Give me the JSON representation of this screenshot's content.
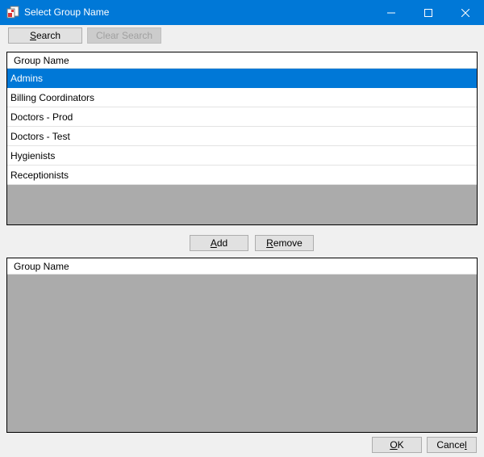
{
  "window": {
    "title": "Select Group Name",
    "icon": "app-window-icon",
    "accent": "#0078d7"
  },
  "toolbar": {
    "search_prefix": "S",
    "search_label": "earch",
    "clear_search_label": "Clear Search"
  },
  "available_list": {
    "column_header": "Group Name",
    "rows": [
      "Admins",
      "Billing Coordinators",
      "Doctors - Prod",
      "Doctors - Test",
      "Hygienists",
      "Receptionists"
    ],
    "selected_index": 0
  },
  "actions": {
    "add_prefix": "A",
    "add_label": "dd",
    "remove_prefix": "R",
    "remove_label": "emove"
  },
  "selected_list": {
    "column_header": "Group Name",
    "rows": []
  },
  "footer": {
    "ok_prefix": "O",
    "ok_label": "K",
    "cancel_text": "Cance",
    "cancel_mnemonic": "l"
  }
}
